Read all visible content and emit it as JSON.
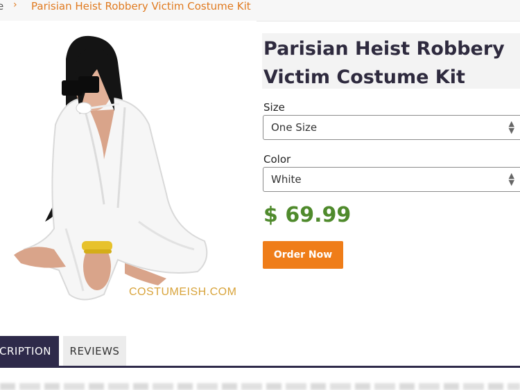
{
  "breadcrumb": {
    "home_fragment": "e",
    "separator": "›",
    "current": "Parisian Heist Robbery Victim Costume Kit"
  },
  "product": {
    "title": "Parisian Heist Robbery Victim Costume Kit",
    "image_watermark": "COSTUMEISH.COM",
    "size": {
      "label": "Size",
      "selected": "One Size"
    },
    "color": {
      "label": "Color",
      "selected": "White"
    },
    "price": "$ 69.99",
    "order_button": "Order Now"
  },
  "tabs": {
    "description": "CRIPTION",
    "reviews": "REVIEWS"
  },
  "colors": {
    "accent_orange": "#ef7d19",
    "price_green": "#4f8a2c",
    "tab_dark": "#2e2a4a",
    "title_text": "#2e2a3e"
  }
}
